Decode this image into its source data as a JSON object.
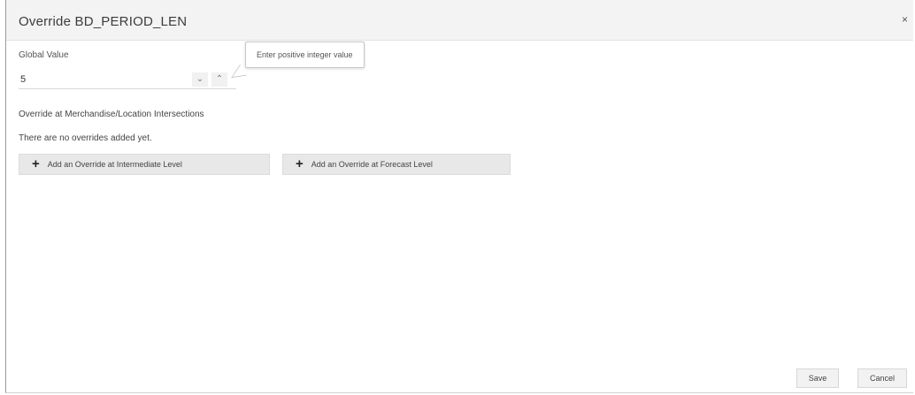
{
  "dialog": {
    "title": "Override BD_PERIOD_LEN",
    "close_label": "×"
  },
  "global_value": {
    "label": "Global Value",
    "value": "5",
    "step_down_icon": "chevron-down-icon",
    "step_up_icon": "chevron-up-icon",
    "step_down_glyph": "⌄",
    "step_up_glyph": "⌃"
  },
  "tooltip": {
    "text": "Enter positive integer value"
  },
  "overrides": {
    "section_label": "Override at Merchandise/Location Intersections",
    "empty_text": "There are no overrides added yet.",
    "add_intermediate_label": "Add an Override at Intermediate Level",
    "add_forecast_label": "Add an Override at Forecast Level",
    "plus_glyph": "+"
  },
  "footer": {
    "save_label": "Save",
    "cancel_label": "Cancel"
  }
}
